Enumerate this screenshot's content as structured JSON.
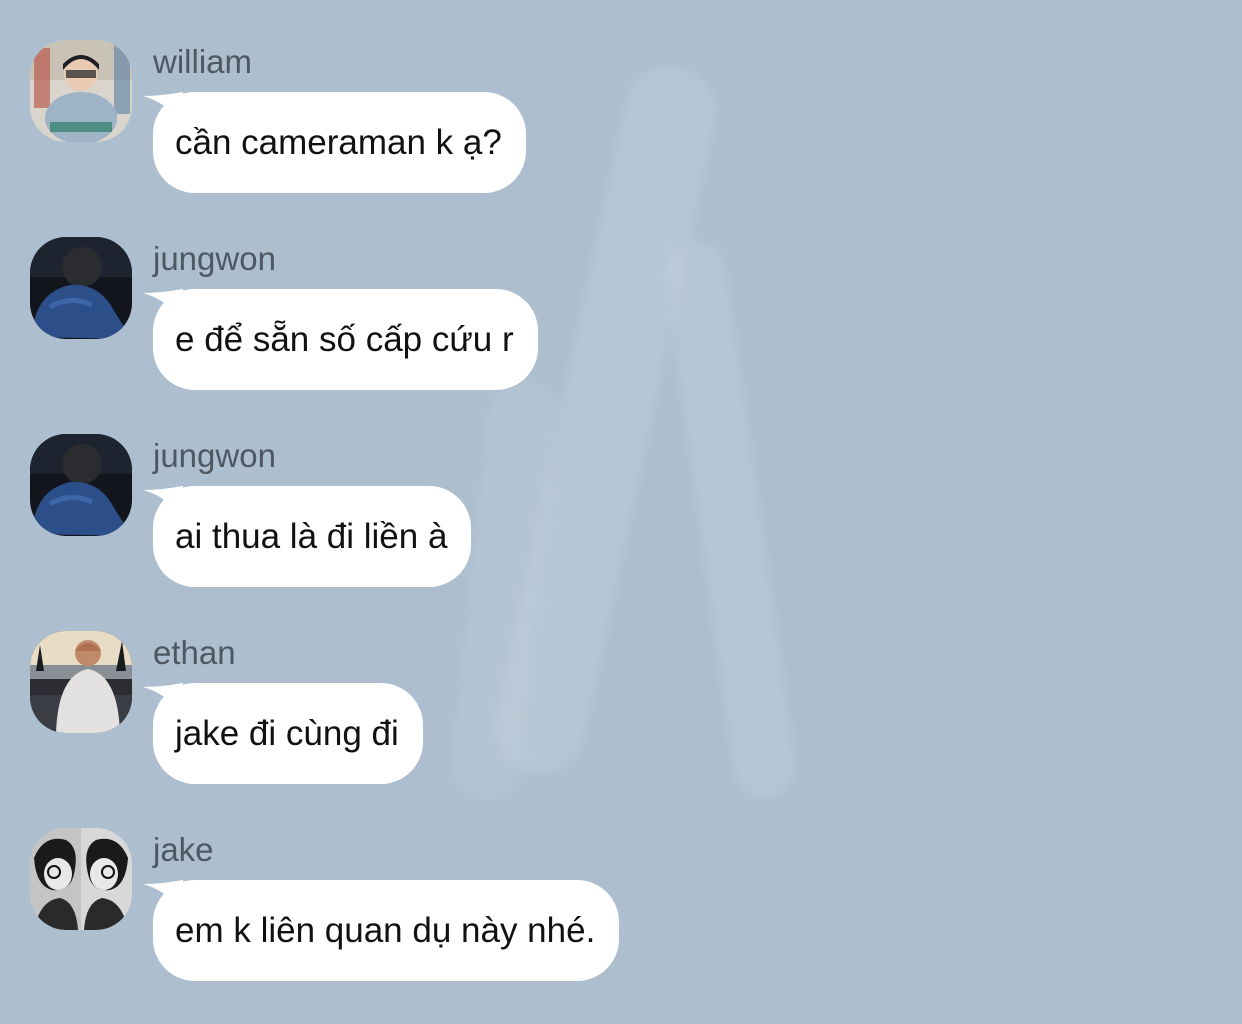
{
  "theme": {
    "background": "#adbfcf",
    "bubble": "#ffffff",
    "sender_text": "#4e5862",
    "message_text": "#111111"
  },
  "messages": [
    {
      "sender": "william",
      "text": "cần cameraman k ạ?",
      "avatar_icon": "william-photo-avatar"
    },
    {
      "sender": "jungwon",
      "text": "e để sẵn số cấp cứu r",
      "avatar_icon": "jungwon-photo-avatar"
    },
    {
      "sender": "jungwon",
      "text": "ai thua là đi liền à",
      "avatar_icon": "jungwon-photo-avatar"
    },
    {
      "sender": "ethan",
      "text": "jake đi cùng đi",
      "avatar_icon": "ethan-photo-avatar"
    },
    {
      "sender": "jake",
      "text": "em k liên quan dụ này nhé.",
      "avatar_icon": "jake-photo-avatar"
    }
  ]
}
